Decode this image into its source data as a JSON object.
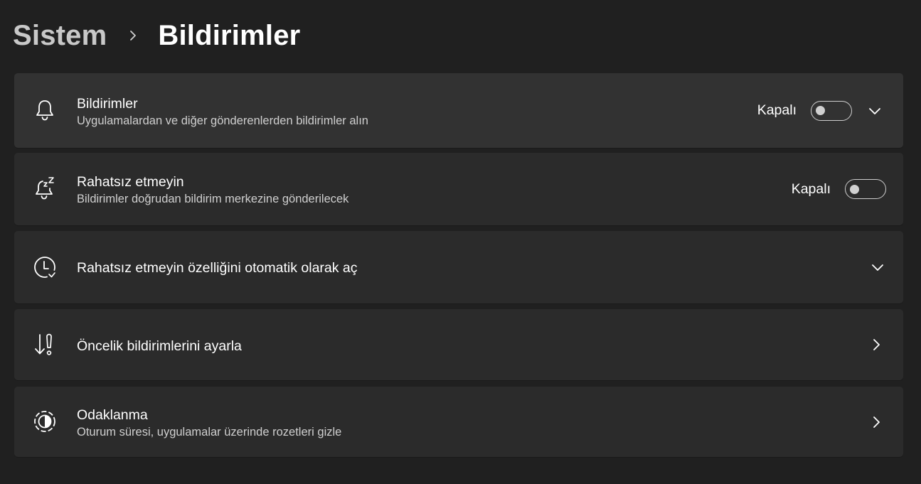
{
  "breadcrumb": {
    "parent": "Sistem",
    "current": "Bildirimler"
  },
  "settings": [
    {
      "title": "Bildirimler",
      "subtitle": "Uygulamalardan ve diğer gönderenlerden bildirimler alın",
      "state": "Kapalı",
      "toggle_on": false,
      "icon": "bell-icon",
      "action": "expand"
    },
    {
      "title": "Rahatsız etmeyin",
      "subtitle": "Bildirimler doğrudan bildirim merkezine gönderilecek",
      "state": "Kapalı",
      "toggle_on": false,
      "icon": "bell-snooze-icon"
    },
    {
      "title": "Rahatsız etmeyin özelliğini otomatik olarak aç",
      "icon": "clock-icon",
      "action": "expand"
    },
    {
      "title": "Öncelik bildirimlerini ayarla",
      "icon": "priority-alert-icon",
      "action": "navigate"
    },
    {
      "title": "Odaklanma",
      "subtitle": "Oturum süresi, uygulamalar üzerinde rozetleri gizle",
      "icon": "focus-icon",
      "action": "navigate"
    }
  ],
  "colors": {
    "background": "#202020",
    "card": "#2b2b2b",
    "card_highlight": "#323232",
    "text_primary": "#ffffff",
    "text_secondary": "#cfcfcf"
  }
}
